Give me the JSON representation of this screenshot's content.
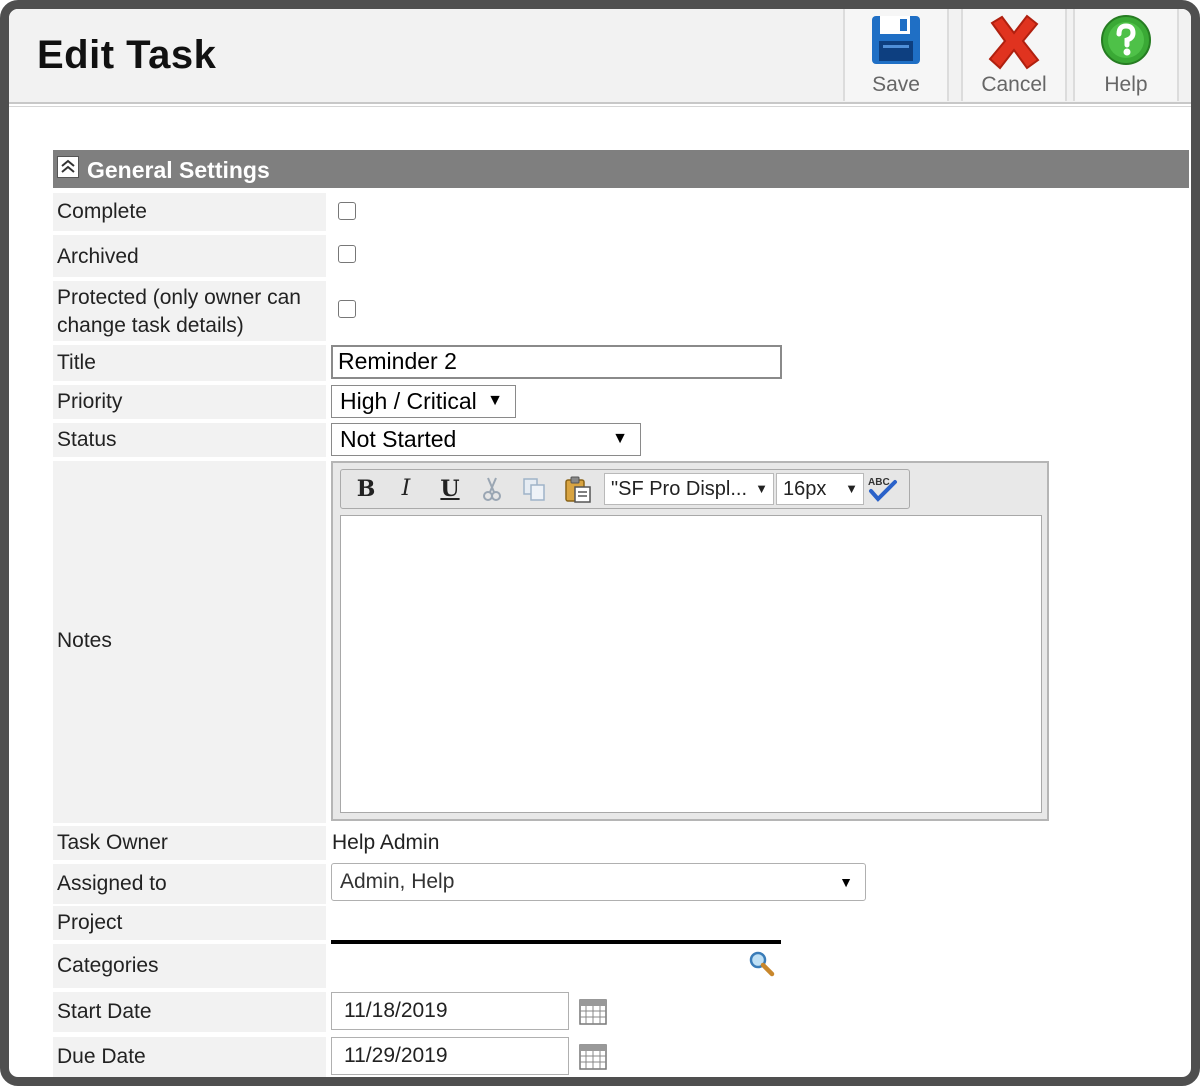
{
  "header": {
    "title": "Edit Task",
    "toolbar": {
      "save_label": "Save",
      "cancel_label": "Cancel",
      "help_label": "Help"
    }
  },
  "section": {
    "title": "General Settings"
  },
  "form": {
    "complete": {
      "label": "Complete",
      "checked": false
    },
    "archived": {
      "label": "Archived",
      "checked": false
    },
    "protected": {
      "label_line1": "Protected (only owner can",
      "label_line2": "change task details)",
      "checked": false
    },
    "title": {
      "label": "Title",
      "value": "Reminder 2"
    },
    "priority": {
      "label": "Priority",
      "value": "High / Critical"
    },
    "status": {
      "label": "Status",
      "value": "Not Started"
    },
    "notes": {
      "label": "Notes",
      "font_value": "\"SF Pro Displ...",
      "size_value": "16px",
      "bold": "B",
      "italic": "I",
      "underline": "U"
    },
    "task_owner": {
      "label": "Task Owner",
      "value": "Help Admin"
    },
    "assigned_to": {
      "label": "Assigned to",
      "value": "Admin, Help"
    },
    "project": {
      "label": "Project"
    },
    "categories": {
      "label": "Categories"
    },
    "start_date": {
      "label": "Start Date",
      "value": "11/18/2019"
    },
    "due_date": {
      "label": "Due Date",
      "value": "11/29/2019"
    }
  },
  "colors": {
    "section_bar": "#7f7f7f",
    "label_bg": "#f2f2f2",
    "save_icon": "#1f6fc5",
    "cancel_icon": "#e0331f",
    "help_icon": "#3aa935"
  },
  "icons": [
    "save-icon",
    "cancel-icon",
    "help-icon",
    "collapse-icon",
    "cut-icon",
    "copy-icon",
    "paste-icon",
    "spellcheck-icon",
    "search-icon",
    "calendar-icon"
  ]
}
